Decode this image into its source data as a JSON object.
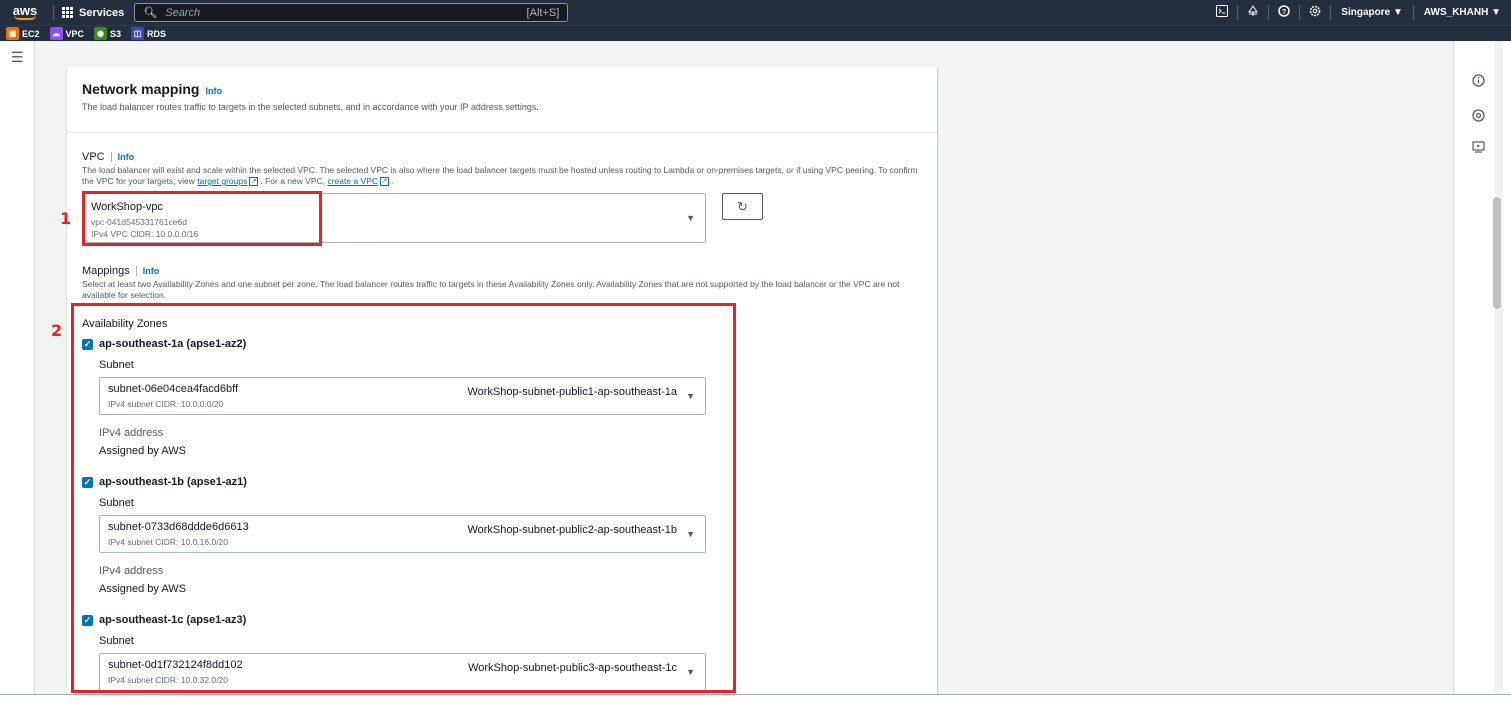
{
  "topnav": {
    "logo": "aws",
    "services_label": "Services",
    "search_placeholder": "Search",
    "search_shortcut": "[Alt+S]",
    "region": "Singapore ▼",
    "account": "AWS_KHANH ▼",
    "icons": [
      "cloudshell-icon",
      "bell-icon",
      "help-icon",
      "settings-icon"
    ]
  },
  "favorites": [
    {
      "label": "EC2",
      "color": "#ed7100",
      "icon": "ec2-icon"
    },
    {
      "label": "VPC",
      "color": "#8c4fff",
      "icon": "vpc-icon"
    },
    {
      "label": "S3",
      "color": "#3f8624",
      "icon": "s3-icon"
    },
    {
      "label": "RDS",
      "color": "#3b48cc",
      "icon": "rds-icon"
    }
  ],
  "panel": {
    "title": "Network mapping",
    "info": "Info",
    "description": "The load balancer routes traffic to targets in the selected subnets, and in accordance with your IP address settings."
  },
  "vpc": {
    "label": "VPC",
    "info": "Info",
    "desc_part1": "The load balancer will exist and scale within the selected VPC. The selected VPC is also where the load balancer targets must be hosted unless routing to Lambda or on-premises targets, or if using VPC peering. To confirm the VPC for your targets, view ",
    "link_target_groups": "target groups",
    "desc_part2": ". For a new VPC, ",
    "link_create_vpc": "create a VPC",
    "desc_part3": ".",
    "selected_name": "WorkShop-vpc",
    "selected_id": "vpc-041d545331761ce6d",
    "selected_cidr": "IPv4 VPC CIDR: 10.0.0.0/16"
  },
  "mappings": {
    "label": "Mappings",
    "info": "Info",
    "description": "Select at least two Availability Zones and one subnet per zone. The load balancer routes traffic to targets in these Availability Zones only. Availability Zones that are not supported by the load balancer or the VPC are not available for selection.",
    "az_heading": "Availability Zones",
    "zones": [
      {
        "name": "ap-southeast-1a (apse1-az2)",
        "subnet_label": "Subnet",
        "subnet_id": "subnet-06e04cea4facd6bff",
        "subnet_cidr": "IPv4 subnet CIDR: 10.0.0.0/20",
        "subnet_name": "WorkShop-subnet-public1-ap-southeast-1a",
        "ipv4_label": "IPv4 address",
        "ipv4_value": "Assigned by AWS"
      },
      {
        "name": "ap-southeast-1b (apse1-az1)",
        "subnet_label": "Subnet",
        "subnet_id": "subnet-0733d68ddde6d6613",
        "subnet_cidr": "IPv4 subnet CIDR: 10.0.16.0/20",
        "subnet_name": "WorkShop-subnet-public2-ap-southeast-1b",
        "ipv4_label": "IPv4 address",
        "ipv4_value": "Assigned by AWS"
      },
      {
        "name": "ap-southeast-1c (apse1-az3)",
        "subnet_label": "Subnet",
        "subnet_id": "subnet-0d1f732124f8dd102",
        "subnet_cidr": "IPv4 subnet CIDR: 10.0.32.0/20",
        "subnet_name": "WorkShop-subnet-public3-ap-southeast-1c"
      }
    ]
  },
  "annotations": {
    "one": "1",
    "two": "2"
  }
}
